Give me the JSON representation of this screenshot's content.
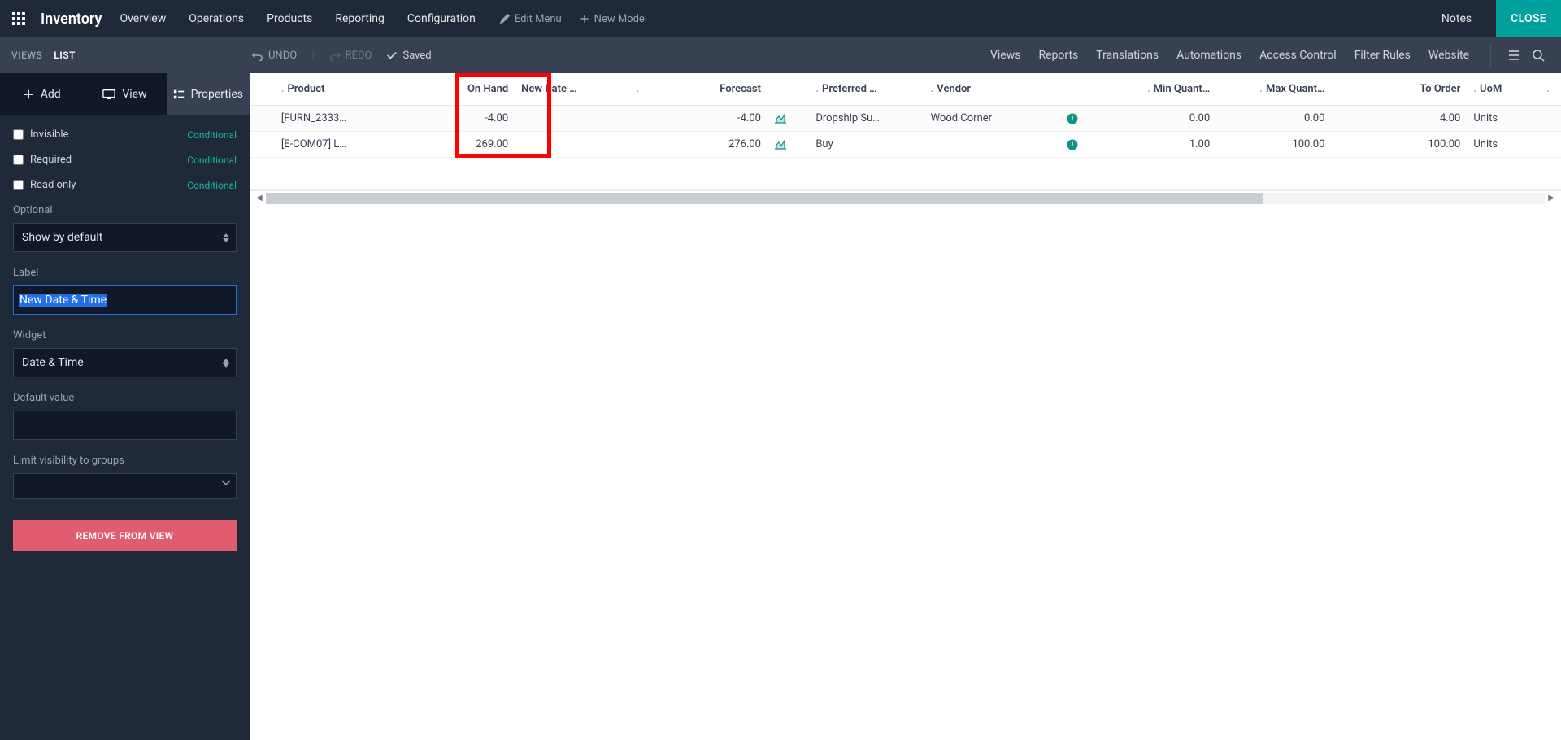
{
  "topbar": {
    "app_name": "Inventory",
    "menu": [
      "Overview",
      "Operations",
      "Products",
      "Reporting",
      "Configuration"
    ],
    "edit_menu": "Edit Menu",
    "new_model": "New Model",
    "notes": "Notes",
    "close": "CLOSE"
  },
  "subbar": {
    "views": "VIEWS",
    "list": "LIST",
    "undo": "UNDO",
    "redo": "REDO",
    "saved": "Saved",
    "right": [
      "Views",
      "Reports",
      "Translations",
      "Automations",
      "Access Control",
      "Filter Rules",
      "Website"
    ]
  },
  "sidebar": {
    "tabs": {
      "add": "Add",
      "view": "View",
      "properties": "Properties"
    },
    "invisible": "Invisible",
    "required": "Required",
    "readonly": "Read only",
    "conditional": "Conditional",
    "optional_label": "Optional",
    "optional_value": "Show by default",
    "label_label": "Label",
    "label_value": "New Date & Time",
    "widget_label": "Widget",
    "widget_value": "Date & Time",
    "default_label": "Default value",
    "default_value": "",
    "groups_label": "Limit visibility to groups",
    "remove": "REMOVE FROM VIEW"
  },
  "table": {
    "headers": {
      "product": "Product",
      "on_hand": "On Hand",
      "new_date": "New Date …",
      "forecast": "Forecast",
      "preferred": "Preferred …",
      "vendor": "Vendor",
      "min_qty": "Min Quant…",
      "max_qty": "Max Quant…",
      "to_order": "To Order",
      "uom": "UoM"
    },
    "rows": [
      {
        "product": "[FURN_2333…",
        "on_hand": "-4.00",
        "new_date": "",
        "forecast": "-4.00",
        "preferred": "Dropship Su…",
        "vendor": "Wood Corner",
        "min_qty": "0.00",
        "max_qty": "0.00",
        "to_order": "4.00",
        "uom": "Units"
      },
      {
        "product": "[E-COM07] L…",
        "on_hand": "269.00",
        "new_date": "",
        "forecast": "276.00",
        "preferred": "Buy",
        "vendor": "",
        "min_qty": "1.00",
        "max_qty": "100.00",
        "to_order": "100.00",
        "uom": "Units"
      }
    ]
  }
}
